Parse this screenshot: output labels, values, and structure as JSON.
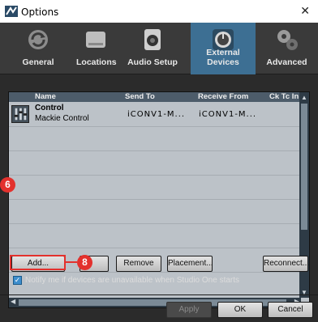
{
  "window": {
    "title": "Options",
    "close_glyph": "✕"
  },
  "tabs": [
    {
      "label": "General",
      "icon": "refresh-icon"
    },
    {
      "label": "Locations",
      "icon": "drive-icon"
    },
    {
      "label": "Audio Setup",
      "icon": "speaker-icon"
    },
    {
      "label": "External Devices",
      "icon": "knob-icon",
      "active": true
    },
    {
      "label": "Advanced",
      "icon": "gears-icon"
    }
  ],
  "device_list": {
    "headers": {
      "name": "Name",
      "send_to": "Send To",
      "receive_from": "Receive From",
      "ck_tc_in": "Ck Tc In"
    },
    "rows": [
      {
        "name": "Control",
        "model": "Mackie Control",
        "send_to": "iCONV1-M...",
        "receive_from": "iCONV1-M..."
      }
    ],
    "scroll_up": "▲",
    "scroll_down": "▼",
    "scroll_left": "◀",
    "scroll_right": "▶"
  },
  "buttons": {
    "add": "Add...",
    "edit": "",
    "remove": "Remove",
    "placement": "Placement...",
    "reconnect": "Reconnect...",
    "apply": "Apply",
    "ok": "OK",
    "cancel": "Cancel"
  },
  "notify": {
    "checked": true,
    "mark": "✓",
    "label": "Notify me if devices are unavailable when Studio One starts"
  },
  "callouts": {
    "list": "6",
    "add": "8"
  },
  "colors": {
    "active_tab": "#3d6f93",
    "callout": "#e3312d",
    "checkbox": "#3e8ecd"
  }
}
